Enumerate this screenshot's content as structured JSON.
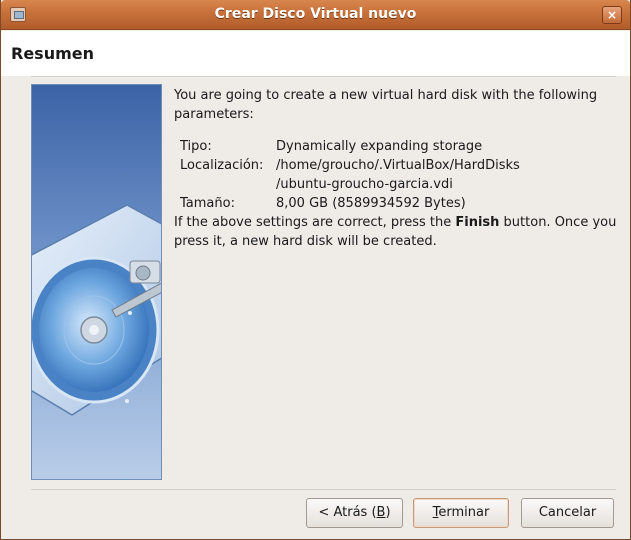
{
  "window": {
    "title": "Crear Disco Virtual nuevo",
    "close_glyph": "×",
    "app_icon": "virtualbox-window-icon"
  },
  "page": {
    "heading": "Resumen",
    "side_image": "hard-disk-illustration"
  },
  "summary": {
    "intro": "You are going to create a new virtual hard disk with the following parameters:",
    "params": [
      {
        "label": "Tipo:",
        "value": "Dynamically expanding storage"
      },
      {
        "label": "Localización:",
        "value": "/home/groucho/.VirtualBox/HardDisks/ubuntu-groucho-garcia.vdi"
      },
      {
        "label": "Tamaño:",
        "value": "8,00 GB (8589934592 Bytes)"
      }
    ],
    "finish_note": {
      "before": "If the above settings are correct, press the ",
      "bold": "Finish",
      "after": " button. Once you press it, a new hard disk will be created."
    }
  },
  "buttons": {
    "back": {
      "pre": "< Atrás (",
      "mnemonic": "B",
      "post": ")"
    },
    "finish": {
      "pre": "",
      "mnemonic": "T",
      "post": "erminar"
    },
    "cancel": {
      "label": "Cancelar"
    }
  },
  "colors": {
    "titlebar": "#c8703a",
    "background": "#efebe7",
    "side_panel": "#6b8fc6"
  }
}
